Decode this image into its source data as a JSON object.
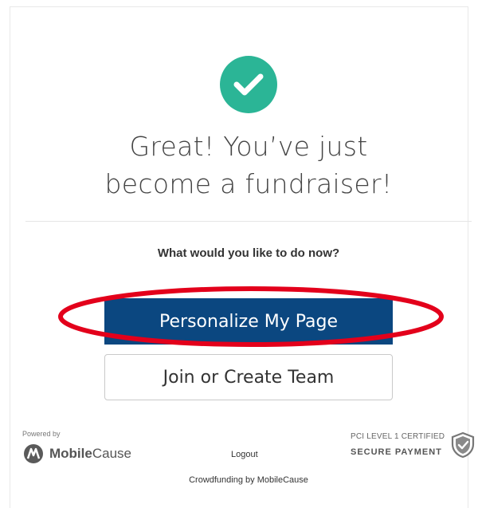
{
  "success": {
    "icon": "check-circle-icon",
    "headline_line1": "Great! You’ve just",
    "headline_line2": "become a fundraiser!",
    "prompt": "What would you like to do now?"
  },
  "actions": {
    "primary_label": "Personalize My Page",
    "secondary_label": "Join or Create Team",
    "highlighted": "primary"
  },
  "footer": {
    "powered_by": "Powered by",
    "brand_bold": "Mobile",
    "brand_regular": "Cause",
    "logout": "Logout",
    "crowdfunding": "Crowdfunding by MobileCause",
    "pci_line1": "PCI LEVEL 1 CERTIFIED",
    "pci_line2": "SECURE PAYMENT",
    "pci_icon": "shield-check-icon"
  },
  "colors": {
    "success_green": "#2bb596",
    "primary_blue": "#0b4780",
    "annotation_red": "#e3001b"
  }
}
